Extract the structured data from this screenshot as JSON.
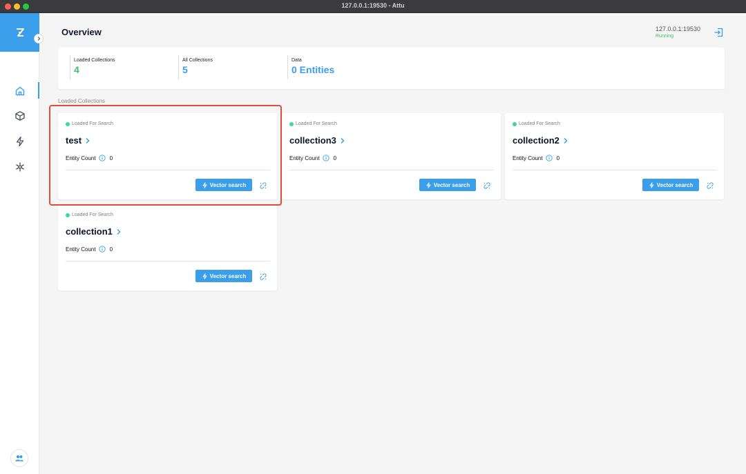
{
  "window": {
    "title": "127.0.0.1:19530 - Attu"
  },
  "header": {
    "title": "Overview",
    "address": "127.0.0.1:19530",
    "status": "Running"
  },
  "stats": [
    {
      "label": "Loaded Collections",
      "value": "4"
    },
    {
      "label": "All Collections",
      "value": "5"
    },
    {
      "label": "Data",
      "value": "0 Entities"
    }
  ],
  "section_label": "Loaded Collections",
  "cards": [
    {
      "status": "Loaded For Search",
      "name": "test",
      "entity_label": "Entity Count",
      "entity_value": "0",
      "button": "Vector search"
    },
    {
      "status": "Loaded For Search",
      "name": "collection3",
      "entity_label": "Entity Count",
      "entity_value": "0",
      "button": "Vector search"
    },
    {
      "status": "Loaded For Search",
      "name": "collection2",
      "entity_label": "Entity Count",
      "entity_value": "0",
      "button": "Vector search"
    },
    {
      "status": "Loaded For Search",
      "name": "collection1",
      "entity_label": "Entity Count",
      "entity_value": "0",
      "button": "Vector search"
    }
  ],
  "nav": [
    {
      "icon": "home-icon"
    },
    {
      "icon": "cube-icon"
    },
    {
      "icon": "lightning-icon"
    },
    {
      "icon": "asterisk-icon"
    }
  ],
  "colors": {
    "accent": "#3a9eea",
    "loaded": "#3dbf6b",
    "status_dot": "#3dd993",
    "highlight": "#e24a3b"
  }
}
